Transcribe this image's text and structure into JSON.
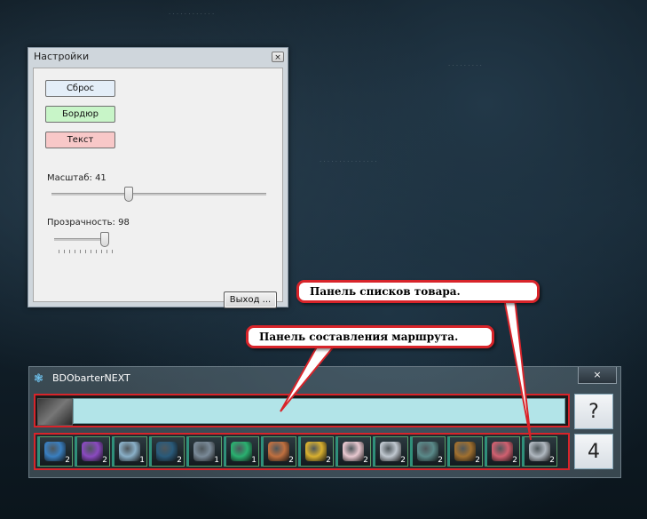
{
  "settings": {
    "title": "Настройки",
    "close_label": "×",
    "buttons": [
      {
        "label": "Сброс",
        "color": "#e4eef8"
      },
      {
        "label": "Бордюр",
        "color": "#c8f5c8"
      },
      {
        "label": "Текст",
        "color": "#f8c8c8"
      }
    ],
    "scale_label": "Масштаб: 41",
    "scale_value": 41,
    "opacity_label": "Прозрачность: 98",
    "opacity_value": 98,
    "exit_label": "Выход ..."
  },
  "app": {
    "title": "BDObarterNEXT",
    "close_label": "×",
    "side_top_label": "?",
    "side_bottom_label": "4",
    "items": [
      {
        "icon": "blue-orb-icon",
        "count": "2",
        "color": "#3a7fc0"
      },
      {
        "icon": "purple-crystal-icon",
        "count": "2",
        "color": "#8a4ac0"
      },
      {
        "icon": "key-icon",
        "count": "1",
        "color": "#8ab0c8"
      },
      {
        "icon": "book-icon",
        "count": "2",
        "color": "#2a5a7a"
      },
      {
        "icon": "statue-icon",
        "count": "1",
        "color": "#7a8a98"
      },
      {
        "icon": "emerald-icon",
        "count": "1",
        "color": "#2ab070"
      },
      {
        "icon": "fish-icon",
        "count": "2",
        "color": "#c07040"
      },
      {
        "icon": "gold-coins-icon",
        "count": "2",
        "color": "#d8b030"
      },
      {
        "icon": "shell-icon",
        "count": "2",
        "color": "#e8c8d0"
      },
      {
        "icon": "dagger-icon",
        "count": "2",
        "color": "#c0c8d0"
      },
      {
        "icon": "hook-icon",
        "count": "2",
        "color": "#5a8a8a"
      },
      {
        "icon": "chest-icon",
        "count": "2",
        "color": "#a07030"
      },
      {
        "icon": "fabric-roll-icon",
        "count": "2",
        "color": "#d06070"
      },
      {
        "icon": "knife-icon",
        "count": "2",
        "color": "#b0b8c0"
      }
    ]
  },
  "callouts": {
    "goods_panel": "Панель списков товара.",
    "route_panel": "Панель составления маршрута."
  }
}
